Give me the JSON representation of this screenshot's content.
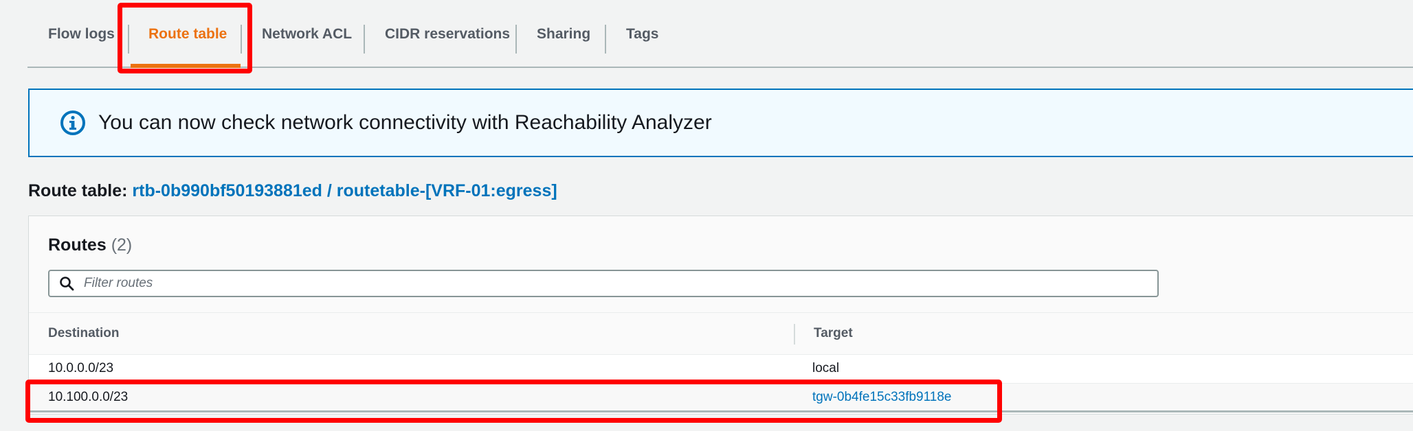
{
  "tabs": [
    {
      "label": "Flow logs",
      "active": false
    },
    {
      "label": "Route table",
      "active": true
    },
    {
      "label": "Network ACL",
      "active": false
    },
    {
      "label": "CIDR reservations",
      "active": false
    },
    {
      "label": "Sharing",
      "active": false
    },
    {
      "label": "Tags",
      "active": false
    }
  ],
  "banner": {
    "icon": "info-icon",
    "text": "You can now check network connectivity with Reachability Analyzer"
  },
  "route_table": {
    "label": "Route table:",
    "id_link": "rtb-0b990bf50193881ed / routetable-[VRF-01:egress]"
  },
  "routes": {
    "title": "Routes",
    "count": "(2)",
    "filter_placeholder": "Filter routes",
    "columns": [
      "Destination",
      "Target"
    ],
    "rows": [
      {
        "destination": "10.0.0.0/23",
        "target": "local",
        "target_is_link": false
      },
      {
        "destination": "10.100.0.0/23",
        "target": "tgw-0b4fe15c33fb9118e",
        "target_is_link": true
      }
    ]
  },
  "colors": {
    "accent": "#ec7211",
    "link": "#0073bb",
    "highlight": "#ff0000",
    "banner_bg": "#f1faff"
  }
}
